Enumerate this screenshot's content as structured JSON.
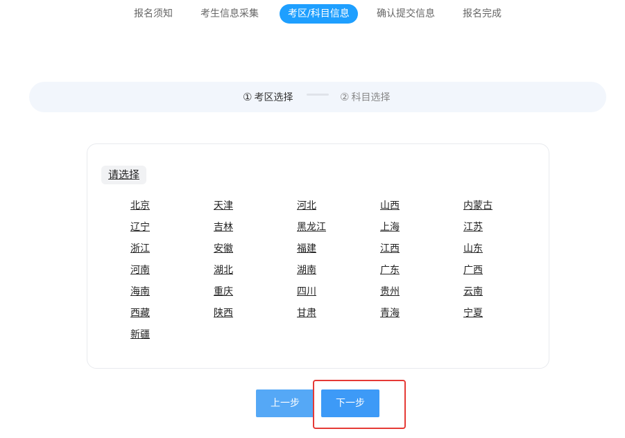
{
  "steps": [
    "报名须知",
    "考生信息采集",
    "考区/科目信息",
    "确认提交信息",
    "报名完成"
  ],
  "active_step_index": 2,
  "substeps": {
    "first": {
      "num": "①",
      "label": "考区选择"
    },
    "second": {
      "num": "②",
      "label": "科目选择"
    }
  },
  "region_panel": {
    "prompt": "请选择",
    "regions": [
      "北京",
      "天津",
      "河北",
      "山西",
      "内蒙古",
      "辽宁",
      "吉林",
      "黑龙江",
      "上海",
      "江苏",
      "浙江",
      "安徽",
      "福建",
      "江西",
      "山东",
      "河南",
      "湖北",
      "湖南",
      "广东",
      "广西",
      "海南",
      "重庆",
      "四川",
      "贵州",
      "云南",
      "西藏",
      "陕西",
      "甘肃",
      "青海",
      "宁夏",
      "新疆"
    ]
  },
  "buttons": {
    "prev": "上一步",
    "next": "下一步"
  },
  "colors": {
    "accent": "#1e9fff",
    "button": "#3d9af7",
    "highlight": "#e53935"
  }
}
